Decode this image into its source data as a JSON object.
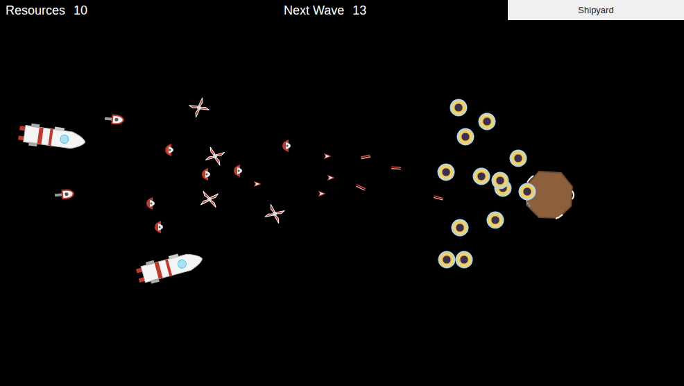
{
  "hud": {
    "resources": {
      "label": "Resources",
      "value": "10"
    },
    "next_wave": {
      "label": "Next Wave",
      "value": "13"
    },
    "shipyard_button": {
      "label": "Shipyard"
    }
  },
  "attackers": [
    {
      "kind": "cruiser"
    },
    {
      "kind": "cruiser"
    },
    {
      "kind": "gunship"
    },
    {
      "kind": "gunship"
    },
    {
      "kind": "fighter"
    },
    {
      "kind": "fighter"
    },
    {
      "kind": "fighter"
    },
    {
      "kind": "fighter"
    },
    {
      "kind": "pod"
    },
    {
      "kind": "pod"
    },
    {
      "kind": "pod"
    },
    {
      "kind": "pod"
    },
    {
      "kind": "pod"
    },
    {
      "kind": "pod"
    },
    {
      "kind": "drone"
    },
    {
      "kind": "drone"
    },
    {
      "kind": "drone"
    },
    {
      "kind": "drone"
    }
  ],
  "projectiles": [
    {
      "kind": "laser"
    },
    {
      "kind": "laser"
    },
    {
      "kind": "laser"
    },
    {
      "kind": "laser"
    }
  ],
  "defenders": [
    {
      "kind": "ring"
    },
    {
      "kind": "ring"
    },
    {
      "kind": "ring"
    },
    {
      "kind": "ring"
    },
    {
      "kind": "ring"
    },
    {
      "kind": "ring"
    },
    {
      "kind": "ring"
    },
    {
      "kind": "ring"
    },
    {
      "kind": "ring"
    },
    {
      "kind": "ring"
    },
    {
      "kind": "ring"
    },
    {
      "kind": "ring"
    },
    {
      "kind": "ring"
    }
  ],
  "base": {
    "kind": "asteroid"
  }
}
